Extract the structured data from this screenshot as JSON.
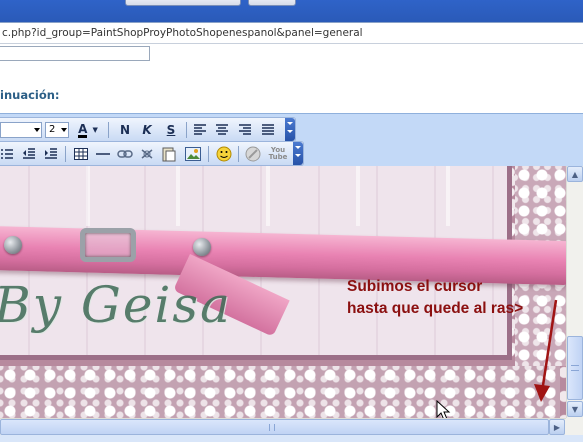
{
  "address": {
    "url": "c.php?id_group=PaintShopProyPhotoShopenespanol&panel=general"
  },
  "section": {
    "heading": "inuación:"
  },
  "toolbar_row1": {
    "font_size": "2",
    "bold": "N",
    "italic": "K",
    "strike": "S"
  },
  "toolbar_row2": {
    "youtube_label": "You\nTube"
  },
  "image": {
    "signature_text": "By Geisa",
    "note_line1": "Subimos el cursor",
    "note_line2": "hasta que quede al ras>",
    "note_color": "#8b1010"
  },
  "colors": {
    "toolbar_bg": "#c3d9f7",
    "heading": "#2c5f87"
  }
}
